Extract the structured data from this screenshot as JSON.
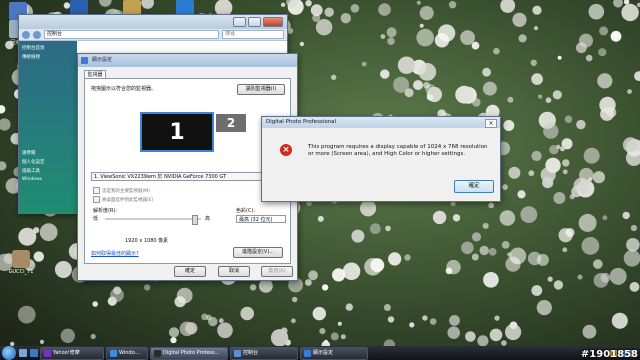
{
  "desktop": {
    "icons": [
      {
        "label": "",
        "color": "#4a78c2"
      },
      {
        "label": "回收筒",
        "color": "#9bb0c4"
      },
      {
        "label": "",
        "color": "#c3a050"
      },
      {
        "label": "",
        "color": "#2b7cd4"
      },
      {
        "label": "",
        "color": "#2b5fb0"
      }
    ],
    "bottom_icon_label": "GUCCI_71"
  },
  "explorer": {
    "address": "控制台",
    "search_placeholder": "搜尋",
    "sidebar_items": [
      "控制台首頁",
      "傳統檢視",
      "",
      "",
      "請參閱",
      "個人化設定",
      "協助工具",
      "Windows"
    ]
  },
  "display_settings": {
    "title": "顯示設定",
    "tab": "監視器",
    "instruction": "拖曳圖示以符合您的監視器。",
    "identify_button": "識別監視器(I)",
    "monitor_1": "1",
    "monitor_2": "2",
    "device": "1. ViewSonic VX2239wm 於 NVIDIA GeForce 7300 GT",
    "checkbox_primary": "這是我的主要監視器(M)",
    "checkbox_extend": "將桌面延伸到此監視器(E)",
    "resolution_label": "解析度(R):",
    "low_label": "低",
    "high_label": "高",
    "resolution_value": "1920 x 1080 像素",
    "colors_label": "色彩(C):",
    "colors_value": "最高 (32 位元)",
    "help_link": "如何取得最佳的顯示?",
    "advanced_button": "進階設定(V)...",
    "ok_button": "確定",
    "cancel_button": "取消",
    "apply_button": "套用(A)"
  },
  "dpp_dialog": {
    "title": "Digital Photo Professional",
    "close_glyph": "×",
    "icon_glyph": "×",
    "message": "This program requires a display capable of 1024 x 768 resolution or more (Screen area), and High Color or higher settings.",
    "ok_button": "確定"
  },
  "taskbar": {
    "tasks": [
      {
        "label": "Yahoo!奇摩",
        "color": "#7b2fbe",
        "active": false
      },
      {
        "label": "Windo...",
        "color": "#3a8de0",
        "active": false
      },
      {
        "label": "Digital Photo Profess...",
        "color": "#2a2a2a",
        "active": true
      },
      {
        "label": "控制台",
        "color": "#5c8fd0",
        "active": false
      },
      {
        "label": "顯示設定",
        "color": "#3a7bd5",
        "active": false
      }
    ],
    "clock": "",
    "watermark": "#1901858"
  },
  "colors": {
    "accent": "#3a86d0",
    "error": "#d6271b"
  }
}
